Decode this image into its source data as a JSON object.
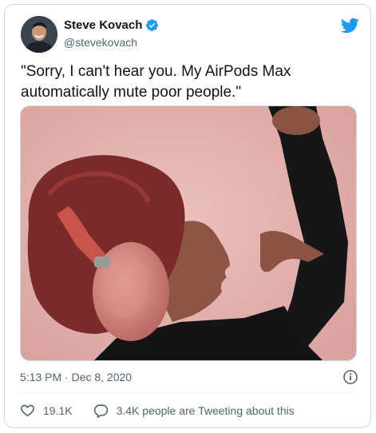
{
  "author": {
    "name": "Steve Kovach",
    "handle": "@stevekovach",
    "verified": true
  },
  "tweet": {
    "text": "\"Sorry, I can't hear you. My AirPods Max automatically mute poor people.\"",
    "timestamp": "5:13 PM · Dec 8, 2020"
  },
  "media": {
    "description_icon": "photo",
    "background_color": "#e3b1ae"
  },
  "actions": {
    "likes_count": "19.1K",
    "conversation_label": "3.4K people are Tweeting about this"
  },
  "colors": {
    "twitter_blue": "#1d9bf0",
    "secondary_text": "#536471",
    "border": "#cfd9de"
  }
}
